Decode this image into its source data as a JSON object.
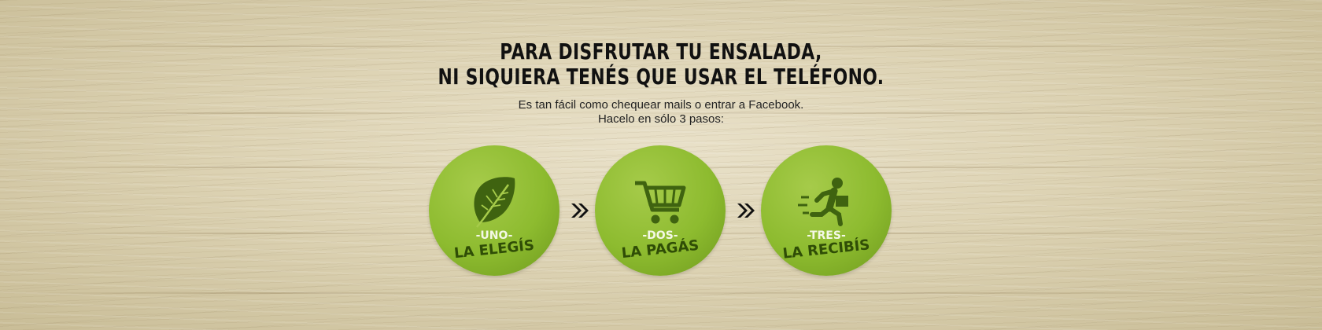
{
  "headline": {
    "line1": "PARA DISFRUTAR TU ENSALADA,",
    "line2": "NI SIQUIERA TENÉS QUE USAR EL TELÉFONO."
  },
  "subtext": {
    "line1": "Es tan fácil como chequear mails o entrar a Facebook.",
    "line2": "Hacelo en sólo 3 pasos:"
  },
  "steps": [
    {
      "number": "-UNO-",
      "label": "LA ELEGÍS",
      "icon": "leaf-icon"
    },
    {
      "number": "-DOS-",
      "label": "LA PAGÁS",
      "icon": "shopping-cart-icon"
    },
    {
      "number": "-TRES-",
      "label": "LA RECIBÍS",
      "icon": "running-delivery-man-icon"
    }
  ],
  "colors": {
    "circle_green": "#8dbb2f",
    "icon_dark_green": "#3f6310",
    "label_dark_green": "#2f4d06",
    "text_dark": "#111111"
  }
}
